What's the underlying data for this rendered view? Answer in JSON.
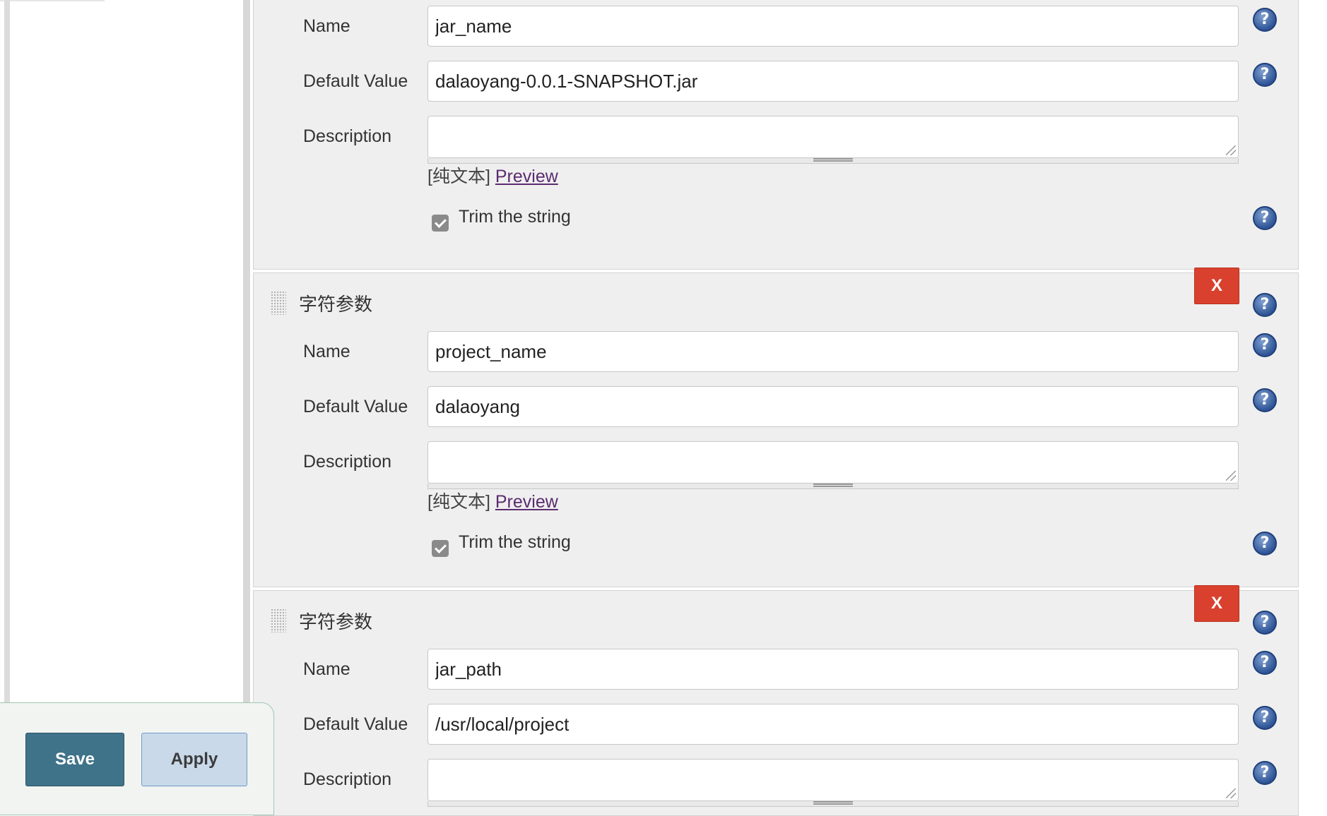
{
  "labels": {
    "name": "Name",
    "default_value": "Default Value",
    "description": "Description",
    "format_prefix": "[纯文本]",
    "preview": "Preview",
    "trim": "Trim the string",
    "delete": "X",
    "help": "?"
  },
  "params": [
    {
      "title": "",
      "name": "jar_name",
      "default_value": "dalaoyang-0.0.1-SNAPSHOT.jar",
      "description": "",
      "trim": true
    },
    {
      "title": "字符参数",
      "name": "project_name",
      "default_value": "dalaoyang",
      "description": "",
      "trim": true
    },
    {
      "title": "字符参数",
      "name": "jar_path",
      "default_value": "/usr/local/project",
      "description": "",
      "trim": true
    }
  ],
  "footer": {
    "save": "Save",
    "apply": "Apply"
  },
  "colors": {
    "delete": "#d9412e",
    "save": "#3f7389",
    "apply": "#c9d9ea",
    "help": "#2f5597",
    "link": "#5b2c6f"
  }
}
